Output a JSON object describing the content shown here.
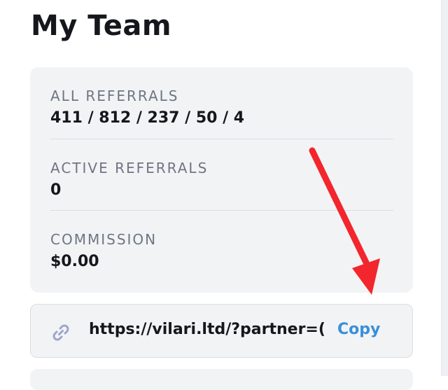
{
  "page": {
    "title": "My Team"
  },
  "stats": [
    {
      "label": "ALL REFERRALS",
      "value": "411 / 812 / 237 / 50 / 4"
    },
    {
      "label": "ACTIVE REFERRALS",
      "value": "0"
    },
    {
      "label": "COMMISSION",
      "value": "$0.00"
    }
  ],
  "referral_link": {
    "url": "https://vilari.ltd/?partner=(",
    "copy_label": "Copy",
    "icon": "link-icon"
  },
  "annotation": {
    "icon": "red-arrow",
    "color": "#f2262c"
  },
  "colors": {
    "accent": "#3a8fd8",
    "card_bg": "#f2f3f5",
    "text": "#15171c",
    "muted": "#6e7684"
  }
}
